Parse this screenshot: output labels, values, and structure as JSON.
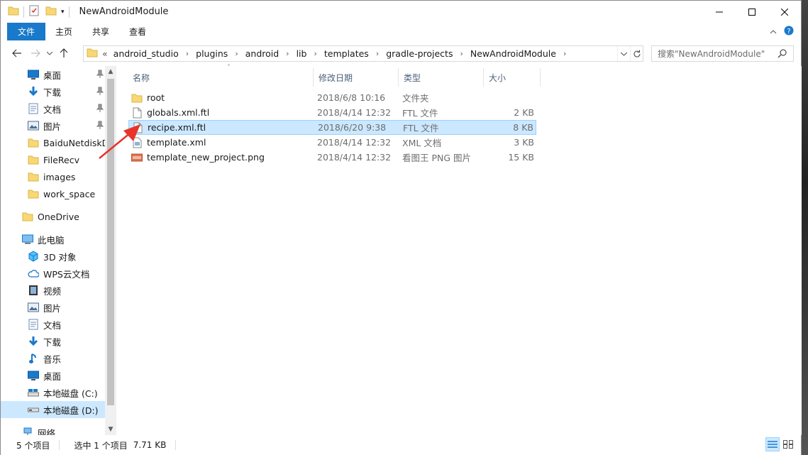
{
  "window": {
    "title": "NewAndroidModule"
  },
  "ribbon": {
    "tabs": [
      "文件",
      "主页",
      "共享",
      "查看"
    ]
  },
  "address": {
    "overflow": "«",
    "crumbs": [
      "android_studio",
      "plugins",
      "android",
      "lib",
      "templates",
      "gradle-projects",
      "NewAndroidModule"
    ]
  },
  "search": {
    "placeholder": "搜索\"NewAndroidModule\""
  },
  "navpane": {
    "items": [
      {
        "label": "桌面",
        "icon": "desktop-icon",
        "pinned": true
      },
      {
        "label": "下载",
        "icon": "download-icon",
        "pinned": true
      },
      {
        "label": "文档",
        "icon": "document-icon",
        "pinned": true
      },
      {
        "label": "图片",
        "icon": "picture-icon",
        "pinned": true
      },
      {
        "label": "BaiduNetdiskD",
        "icon": "folder-icon",
        "pinned": false
      },
      {
        "label": "FileRecv",
        "icon": "folder-icon",
        "pinned": false
      },
      {
        "label": "images",
        "icon": "folder-icon",
        "pinned": false
      },
      {
        "label": "work_space",
        "icon": "folder-icon",
        "pinned": false
      },
      {
        "label": "OneDrive",
        "icon": "folder-icon",
        "pinned": false
      },
      {
        "label": "此电脑",
        "icon": "computer-icon",
        "pinned": false
      },
      {
        "label": "3D 对象",
        "icon": "3d-objects-icon",
        "pinned": false
      },
      {
        "label": "WPS云文档",
        "icon": "cloud-icon",
        "pinned": false
      },
      {
        "label": "视频",
        "icon": "video-icon",
        "pinned": false
      },
      {
        "label": "图片",
        "icon": "picture-icon",
        "pinned": false
      },
      {
        "label": "文档",
        "icon": "document-icon",
        "pinned": false
      },
      {
        "label": "下载",
        "icon": "download-icon",
        "pinned": false
      },
      {
        "label": "音乐",
        "icon": "music-icon",
        "pinned": false
      },
      {
        "label": "桌面",
        "icon": "desktop-icon",
        "pinned": false
      },
      {
        "label": "本地磁盘 (C:)",
        "icon": "drive-c-icon",
        "pinned": false
      },
      {
        "label": "本地磁盘 (D:)",
        "icon": "drive-d-icon",
        "pinned": false
      },
      {
        "label": "网络",
        "icon": "network-icon",
        "pinned": false
      }
    ]
  },
  "columns": {
    "name": "名称",
    "date": "修改日期",
    "type": "类型",
    "size": "大小"
  },
  "files": [
    {
      "name": "root",
      "date": "2018/6/8 10:16",
      "type": "文件夹",
      "size": "",
      "icon": "folder-icon"
    },
    {
      "name": "globals.xml.ftl",
      "date": "2018/4/14 12:32",
      "type": "FTL 文件",
      "size": "2 KB",
      "icon": "file-icon"
    },
    {
      "name": "recipe.xml.ftl",
      "date": "2018/6/20 9:38",
      "type": "FTL 文件",
      "size": "8 KB",
      "icon": "file-icon",
      "selected": true
    },
    {
      "name": "template.xml",
      "date": "2018/4/14 12:32",
      "type": "XML 文档",
      "size": "3 KB",
      "icon": "xml-file-icon"
    },
    {
      "name": "template_new_project.png",
      "date": "2018/4/14 12:32",
      "type": "看图王 PNG 图片",
      "size": "15 KB",
      "icon": "png-file-icon"
    }
  ],
  "status": {
    "count": "5 个项目",
    "selected": "选中 1 个项目",
    "size": "7.71 KB"
  },
  "colors": {
    "accent": "#1979ca",
    "selection": "#cce8ff",
    "folder": "#f8d775",
    "arrow": "#e8332a"
  }
}
